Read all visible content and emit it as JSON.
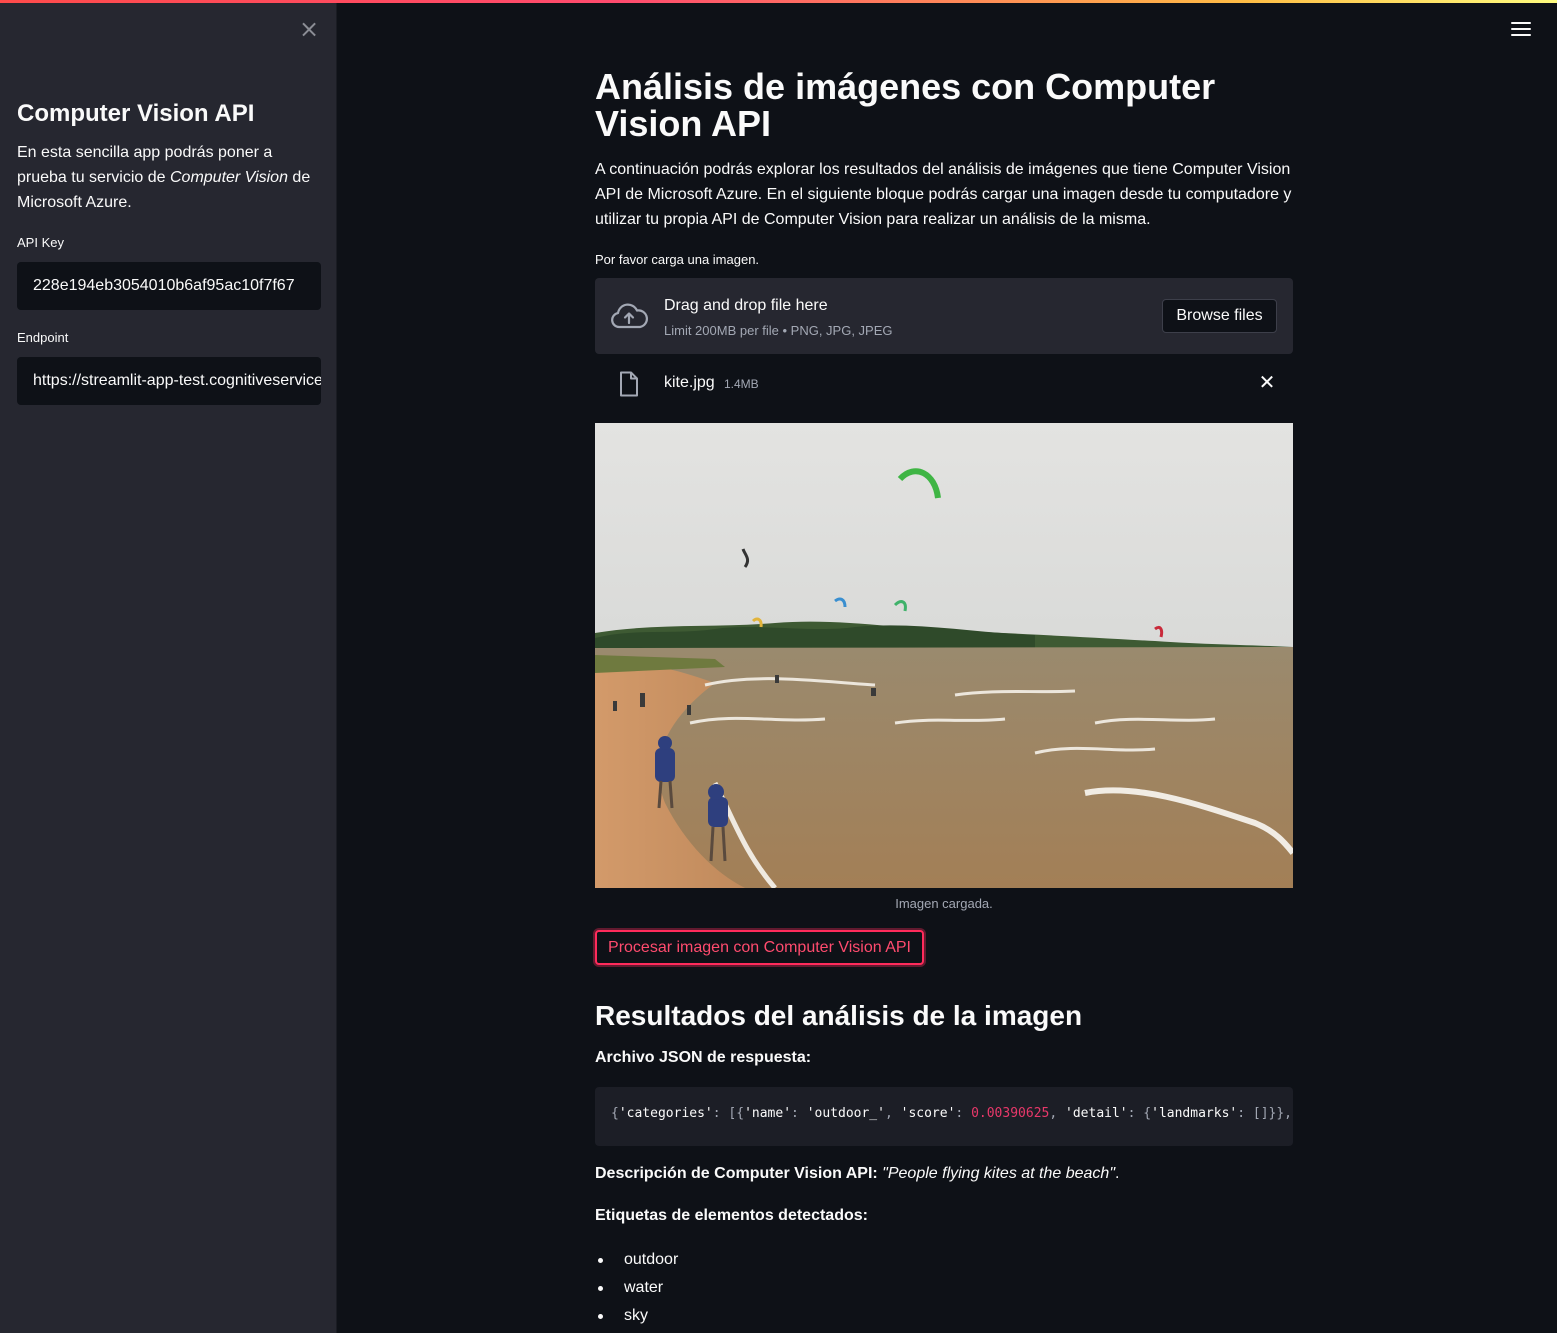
{
  "sidebar": {
    "title": "Computer Vision API",
    "description_before": "En esta sencilla app podrás poner a prueba tu servicio de ",
    "description_emphasis": "Computer Vision",
    "description_after": " de Microsoft Azure.",
    "api_key_label": "API Key",
    "api_key_value": "228e194eb3054010b6af95ac10f7f67",
    "endpoint_label": "Endpoint",
    "endpoint_value": "https://streamlit-app-test.cognitiveservices.azure.com/"
  },
  "main": {
    "title": "Análisis de imágenes con Computer Vision API",
    "intro": "A continuación podrás explorar los resultados del análisis de imágenes que tiene Computer Vision API de Microsoft Azure. En el siguiente bloque podrás cargar una imagen desde tu computadore y utilizar tu propia API de Computer Vision para realizar un análisis de la misma.",
    "upload_label": "Por favor carga una imagen.",
    "dropzone": {
      "title": "Drag and drop file here",
      "limit": "Limit 200MB per file • PNG, JPG, JPEG",
      "browse_label": "Browse files"
    },
    "file": {
      "name": "kite.jpg",
      "size": "1.4MB"
    },
    "image_caption": "Imagen cargada.",
    "process_button": "Procesar imagen con Computer Vision API",
    "results_title": "Resultados del análisis de la imagen",
    "json_label": "Archivo JSON de respuesta:",
    "json": {
      "open": "{",
      "k_categories": "'categories'",
      "colon1": ": [{",
      "k_name": "'name'",
      "colon2": ": ",
      "v_name": "'outdoor_'",
      "comma1": ", ",
      "k_score": "'score'",
      "colon3": ": ",
      "v_score": "0.00390625",
      "comma2": ", ",
      "k_detail": "'detail'",
      "colon4": ": {",
      "k_landmarks": "'landmarks'",
      "tail": ": []}}, {"
    },
    "description_label": "Descripción de Computer Vision API:",
    "description_text": "\"People flying kites at the beach\"",
    "description_end": ".",
    "tags_label": "Etiquetas de elementos detectados:",
    "tags": [
      "outdoor",
      "water",
      "sky"
    ]
  },
  "icons": {
    "close": "×",
    "menu": "hamburger-icon",
    "upload": "cloud-upload-icon",
    "file": "file-icon",
    "remove": "✕"
  },
  "colors": {
    "accent": "#ff4b6e",
    "background": "#0e1117",
    "sidebar": "#262730"
  }
}
